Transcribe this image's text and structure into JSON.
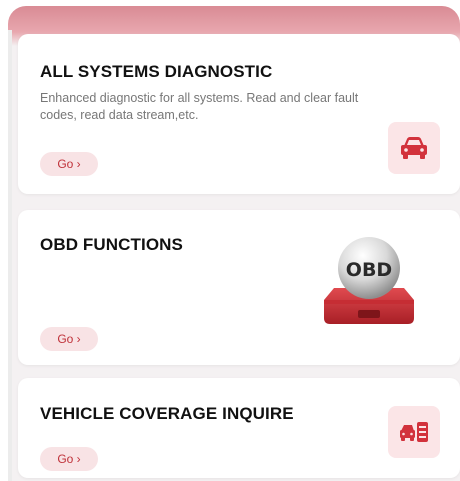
{
  "cards": [
    {
      "title": "ALL SYSTEMS DIAGNOSTIC",
      "description": "Enhanced diagnostic for all systems. Read and clear fault codes, read data stream,etc.",
      "go_label": "Go ›",
      "icon": "car-icon"
    },
    {
      "title": "OBD FUNCTIONS",
      "go_label": "Go ›",
      "icon": "obd-device-icon",
      "icon_text": "OBD"
    },
    {
      "title": "VEHICLE COVERAGE INQUIRE",
      "go_label": "Go ›",
      "icon": "vehicle-coverage-icon"
    }
  ],
  "colors": {
    "accent": "#c0333b",
    "accent_light": "#f8e3e5",
    "header_gradient": "#d98b94"
  }
}
